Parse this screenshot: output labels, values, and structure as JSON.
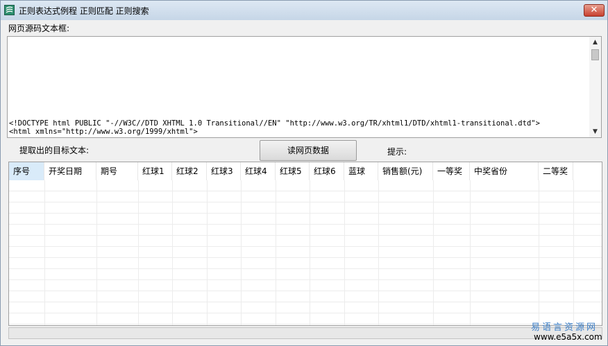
{
  "window": {
    "title": "正则表达式例程 正则匹配 正则搜索",
    "close_label": "✕",
    "icon": "app-icon"
  },
  "source_section": {
    "label": "网页源码文本框:",
    "lines": [
      "<!DOCTYPE html PUBLIC \"-//W3C//DTD XHTML 1.0 Transitional//EN\" \"http://www.w3.org/TR/xhtml1/DTD/xhtml1-transitional.dtd\">",
      "<html xmlns=\"http://www.w3.org/1999/xhtml\">"
    ]
  },
  "target_label": "提取出的目标文本:",
  "read_button_label": "读网页数据",
  "hint_label": "提示:",
  "table": {
    "columns": [
      "序号",
      "开奖日期",
      "期号",
      "红球1",
      "红球2",
      "红球3",
      "红球4",
      "红球5",
      "红球6",
      "蓝球",
      "销售额(元)",
      "一等奖",
      "中奖省份",
      "二等奖"
    ],
    "rows": []
  },
  "watermark": {
    "cn": "易语言资源网",
    "url": "www.e5a5x.com"
  }
}
